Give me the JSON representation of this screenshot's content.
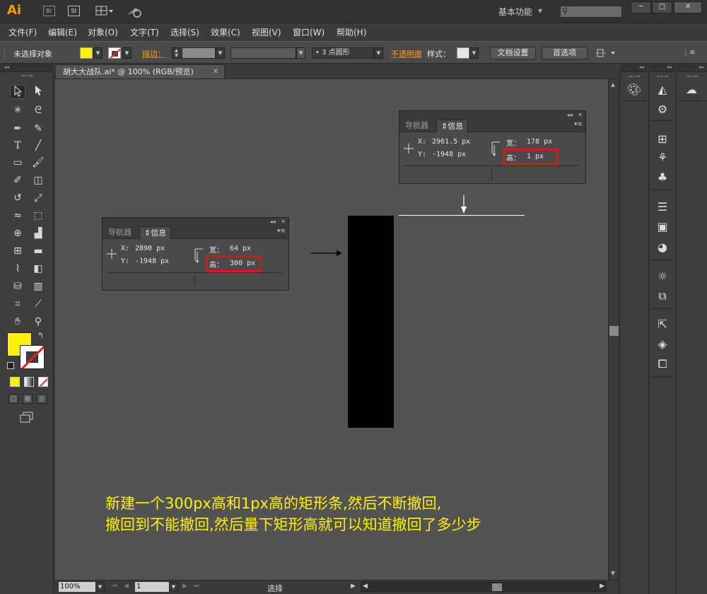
{
  "titlebar": {
    "logo": "Ai",
    "br": "Br",
    "st": "St",
    "workspace": "基本功能",
    "search_placeholder": "",
    "min": "─",
    "max": "□",
    "close": "✕"
  },
  "menu": [
    "文件(F)",
    "编辑(E)",
    "对象(O)",
    "文字(T)",
    "选择(S)",
    "效果(C)",
    "视图(V)",
    "窗口(W)",
    "帮助(H)"
  ],
  "control": {
    "no_selection": "未选择对象",
    "stroke_label": "描边：",
    "brush_label": "• 3 点圆形",
    "opacity_label": "不透明度",
    "style_label": "样式：",
    "doc_setup": "文档设置",
    "preferences": "首选项"
  },
  "document_tab": {
    "title": "胡大大战队.ai* @ 100% (RGB/预览)",
    "close": "✕"
  },
  "colors": {
    "fill": "#fff200",
    "stroke_slash": "#e2231a",
    "highlight": "#e0141a",
    "caption": "#fff200"
  },
  "info_panel_1": {
    "tab_navigator": "导航器",
    "tab_info": "信息",
    "x_label": "X:",
    "x_value": "2890 px",
    "y_label": "Y:",
    "y_value": "-1948 px",
    "w_label": "宽：",
    "w_value": "64 px",
    "h_label": "高：",
    "h_value": "300 px"
  },
  "info_panel_2": {
    "tab_navigator": "导航器",
    "tab_info": "信息",
    "x_label": "X:",
    "x_value": "2961.5 px",
    "y_label": "Y:",
    "y_value": "-1948 px",
    "w_label": "宽：",
    "w_value": "178 px",
    "h_label": "高：",
    "h_value": "1 px"
  },
  "caption": {
    "line1": "新建一个300px高和1px高的矩形条,然后不断撤回,",
    "line2": "撤回到不能撤回,然后量下矩形高就可以知道撤回了多少步"
  },
  "statusbar": {
    "zoom": "100%",
    "page": "1",
    "status": "选择"
  },
  "icons": {
    "tools": [
      "selection-tool-icon",
      "direct-selection-tool-icon",
      "magic-wand-icon",
      "lasso-icon",
      "pen-icon",
      "curvature-icon",
      "type-icon",
      "line-icon",
      "rectangle-icon",
      "paintbrush-icon",
      "blob-brush-icon",
      "eraser-icon",
      "rotate-icon",
      "scale-icon",
      "width-icon",
      "free-transform-icon",
      "shape-builder-icon",
      "chart-icon",
      "mesh-icon",
      "gradient-icon",
      "eyedropper-icon",
      "blend-icon",
      "symbol-sprayer-icon",
      "column-graph-icon",
      "artboard-icon",
      "slice-icon",
      "hand-icon",
      "zoom-icon"
    ]
  }
}
